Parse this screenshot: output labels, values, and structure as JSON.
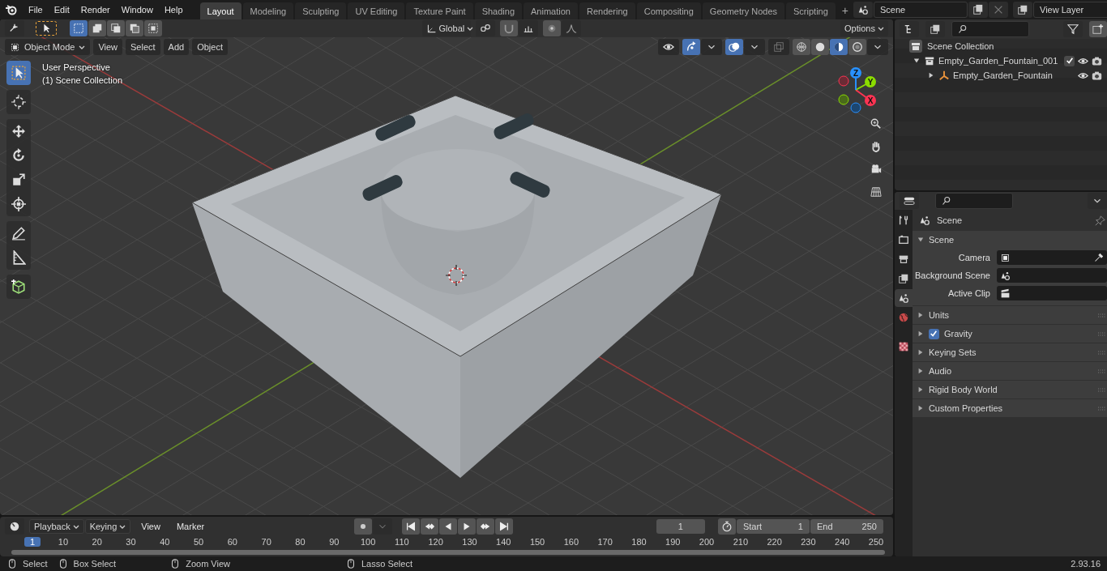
{
  "topbar": {
    "menus": [
      "File",
      "Edit",
      "Render",
      "Window",
      "Help"
    ],
    "workspaces": [
      {
        "label": "Layout",
        "selected": true
      },
      {
        "label": "Modeling",
        "selected": false
      },
      {
        "label": "Sculpting",
        "selected": false
      },
      {
        "label": "UV Editing",
        "selected": false
      },
      {
        "label": "Texture Paint",
        "selected": false
      },
      {
        "label": "Shading",
        "selected": false
      },
      {
        "label": "Animation",
        "selected": false
      },
      {
        "label": "Rendering",
        "selected": false
      },
      {
        "label": "Compositing",
        "selected": false
      },
      {
        "label": "Geometry Nodes",
        "selected": false
      },
      {
        "label": "Scripting",
        "selected": false
      }
    ],
    "add_workspace": "+",
    "scene": "Scene",
    "view_layer": "View Layer"
  },
  "viewport": {
    "header": {
      "orientation": "Global",
      "options": "Options",
      "mode": "Object Mode",
      "menus": [
        "View",
        "Select",
        "Add",
        "Object"
      ],
      "selection_modes": [
        {
          "selected": true
        },
        {
          "selected": false
        },
        {
          "selected": false
        },
        {
          "selected": false
        },
        {
          "selected": false
        }
      ],
      "shading_modes": [
        {
          "selected": false
        },
        {
          "selected": false
        },
        {
          "selected": true
        },
        {
          "selected": false
        }
      ]
    },
    "info": [
      "User Perspective",
      "(1) Scene Collection"
    ],
    "tool_groups": [
      [
        {
          "kind": "select",
          "selected": true
        }
      ],
      [
        {
          "kind": "cursor",
          "selected": false
        }
      ],
      [
        {
          "kind": "move",
          "selected": false
        },
        {
          "kind": "rotate",
          "selected": false
        },
        {
          "kind": "scale",
          "selected": false
        },
        {
          "kind": "transform",
          "selected": false
        }
      ],
      [
        {
          "kind": "annotate",
          "selected": false
        },
        {
          "kind": "measure",
          "selected": false
        }
      ],
      [
        {
          "kind": "add-cube",
          "selected": false
        }
      ]
    ],
    "gizmo_axes": [
      "X",
      "Y",
      "Z"
    ]
  },
  "outliner": {
    "root": "Scene Collection",
    "tree": [
      {
        "label": "Empty_Garden_Fountain_001",
        "kind": "collection",
        "expanded": true,
        "checked": true,
        "children": [
          {
            "label": "Empty_Garden_Fountain",
            "kind": "empty",
            "expanded": false
          }
        ]
      }
    ]
  },
  "properties": {
    "tabs": [
      {
        "kind": "tool",
        "selected": false
      },
      {
        "kind": "render",
        "selected": false
      },
      {
        "kind": "output",
        "selected": false
      },
      {
        "kind": "view-layer",
        "selected": false
      },
      {
        "kind": "scene",
        "selected": true
      },
      {
        "kind": "world",
        "selected": false
      },
      {
        "kind": "texture",
        "selected": false
      }
    ],
    "context": "Scene",
    "panel": {
      "title": "Scene",
      "expanded": true,
      "fields": [
        {
          "label": "Camera",
          "kind": "camera"
        },
        {
          "label": "Background Scene",
          "kind": "scene"
        },
        {
          "label": "Active Clip",
          "kind": "clip"
        }
      ]
    },
    "subpanels": [
      {
        "title": "Units",
        "kind": "plain",
        "expanded": false
      },
      {
        "title": "Gravity",
        "kind": "toggle",
        "checked": true,
        "expanded": false
      },
      {
        "title": "Keying Sets",
        "kind": "plain",
        "expanded": false
      },
      {
        "title": "Audio",
        "kind": "plain",
        "expanded": false
      },
      {
        "title": "Rigid Body World",
        "kind": "plain",
        "expanded": false
      },
      {
        "title": "Custom Properties",
        "kind": "plain",
        "expanded": false
      }
    ]
  },
  "timeline": {
    "dropdowns": [
      "Playback",
      "Keying"
    ],
    "menus": [
      "View",
      "Marker"
    ],
    "current_frame": "1",
    "start_label": "Start",
    "start": "1",
    "end_label": "End",
    "end": "250",
    "ruler": [
      {
        "label": "1",
        "selected": true
      },
      {
        "label": "10",
        "selected": false
      },
      {
        "label": "20",
        "selected": false
      },
      {
        "label": "30",
        "selected": false
      },
      {
        "label": "40",
        "selected": false
      },
      {
        "label": "50",
        "selected": false
      },
      {
        "label": "60",
        "selected": false
      },
      {
        "label": "70",
        "selected": false
      },
      {
        "label": "80",
        "selected": false
      },
      {
        "label": "90",
        "selected": false
      },
      {
        "label": "100",
        "selected": false
      },
      {
        "label": "110",
        "selected": false
      },
      {
        "label": "120",
        "selected": false
      },
      {
        "label": "130",
        "selected": false
      },
      {
        "label": "140",
        "selected": false
      },
      {
        "label": "150",
        "selected": false
      },
      {
        "label": "160",
        "selected": false
      },
      {
        "label": "170",
        "selected": false
      },
      {
        "label": "180",
        "selected": false
      },
      {
        "label": "190",
        "selected": false
      },
      {
        "label": "200",
        "selected": false
      },
      {
        "label": "210",
        "selected": false
      },
      {
        "label": "220",
        "selected": false
      },
      {
        "label": "230",
        "selected": false
      },
      {
        "label": "240",
        "selected": false
      },
      {
        "label": "250",
        "selected": false
      }
    ]
  },
  "status_bar": {
    "hints": [
      "Select",
      "Box Select",
      "Zoom View",
      "Lasso Select"
    ],
    "version": "2.93.16"
  }
}
